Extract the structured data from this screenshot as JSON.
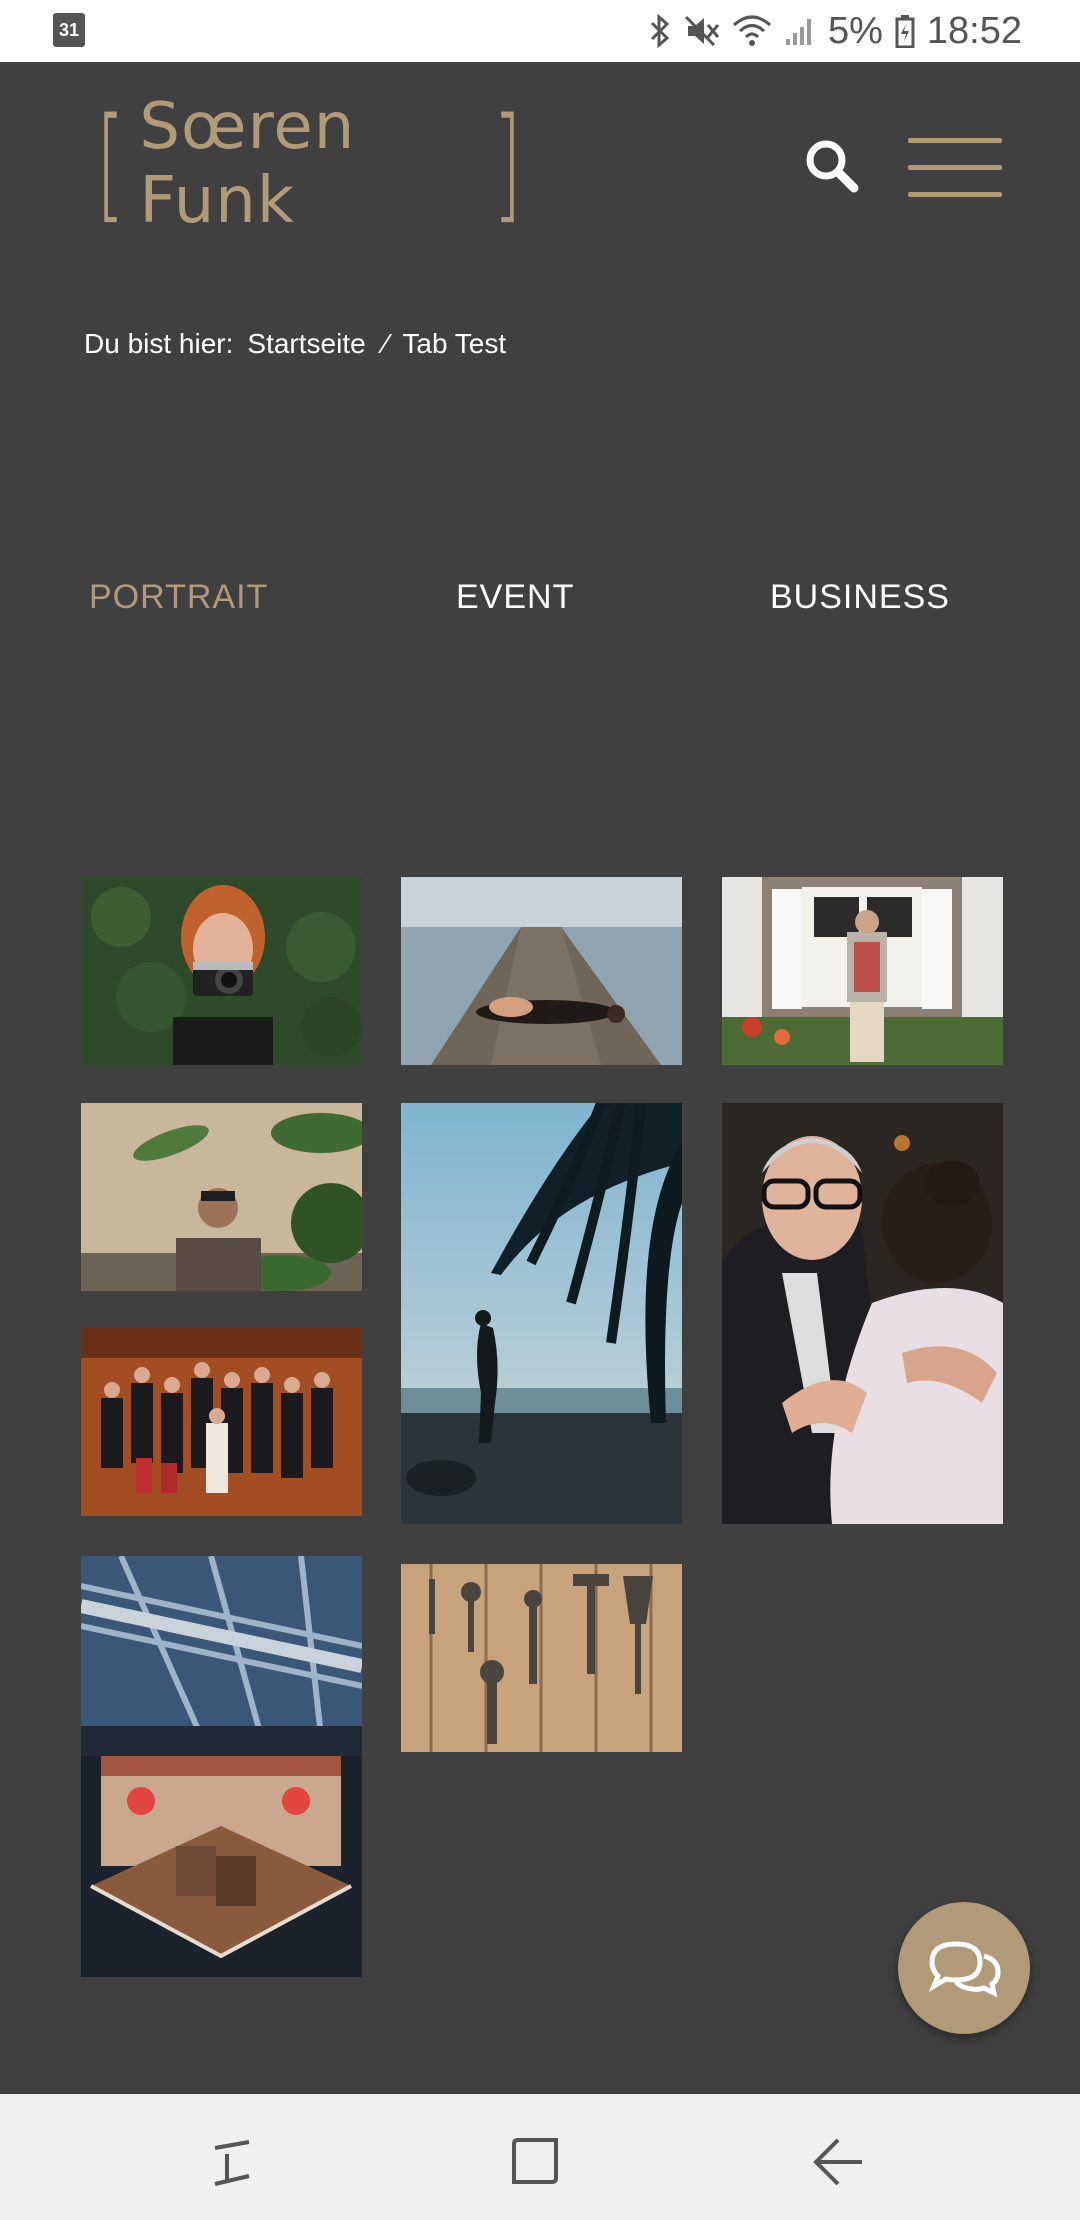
{
  "status_bar": {
    "calendar_day": "31",
    "battery_percent": "5%",
    "time": "18:52"
  },
  "header": {
    "logo_text": "Sœren Funk",
    "brand_color": "#b09a78"
  },
  "breadcrumb": {
    "prefix": "Du bist hier:",
    "home": "Startseite",
    "separator": "⁄",
    "current": "Tab Test"
  },
  "tabs": [
    {
      "label": "PORTRAIT",
      "active": true
    },
    {
      "label": "EVENT",
      "active": false
    },
    {
      "label": "BUSINESS",
      "active": false
    }
  ],
  "gallery": {
    "photos": [
      "woman-with-camera",
      "woman-on-pier",
      "man-at-window",
      "man-with-plant",
      "silhouette-palm-beach",
      "elderly-man-hug",
      "group-photo",
      "hall-exhibition-booth",
      "tools-on-wood"
    ]
  }
}
